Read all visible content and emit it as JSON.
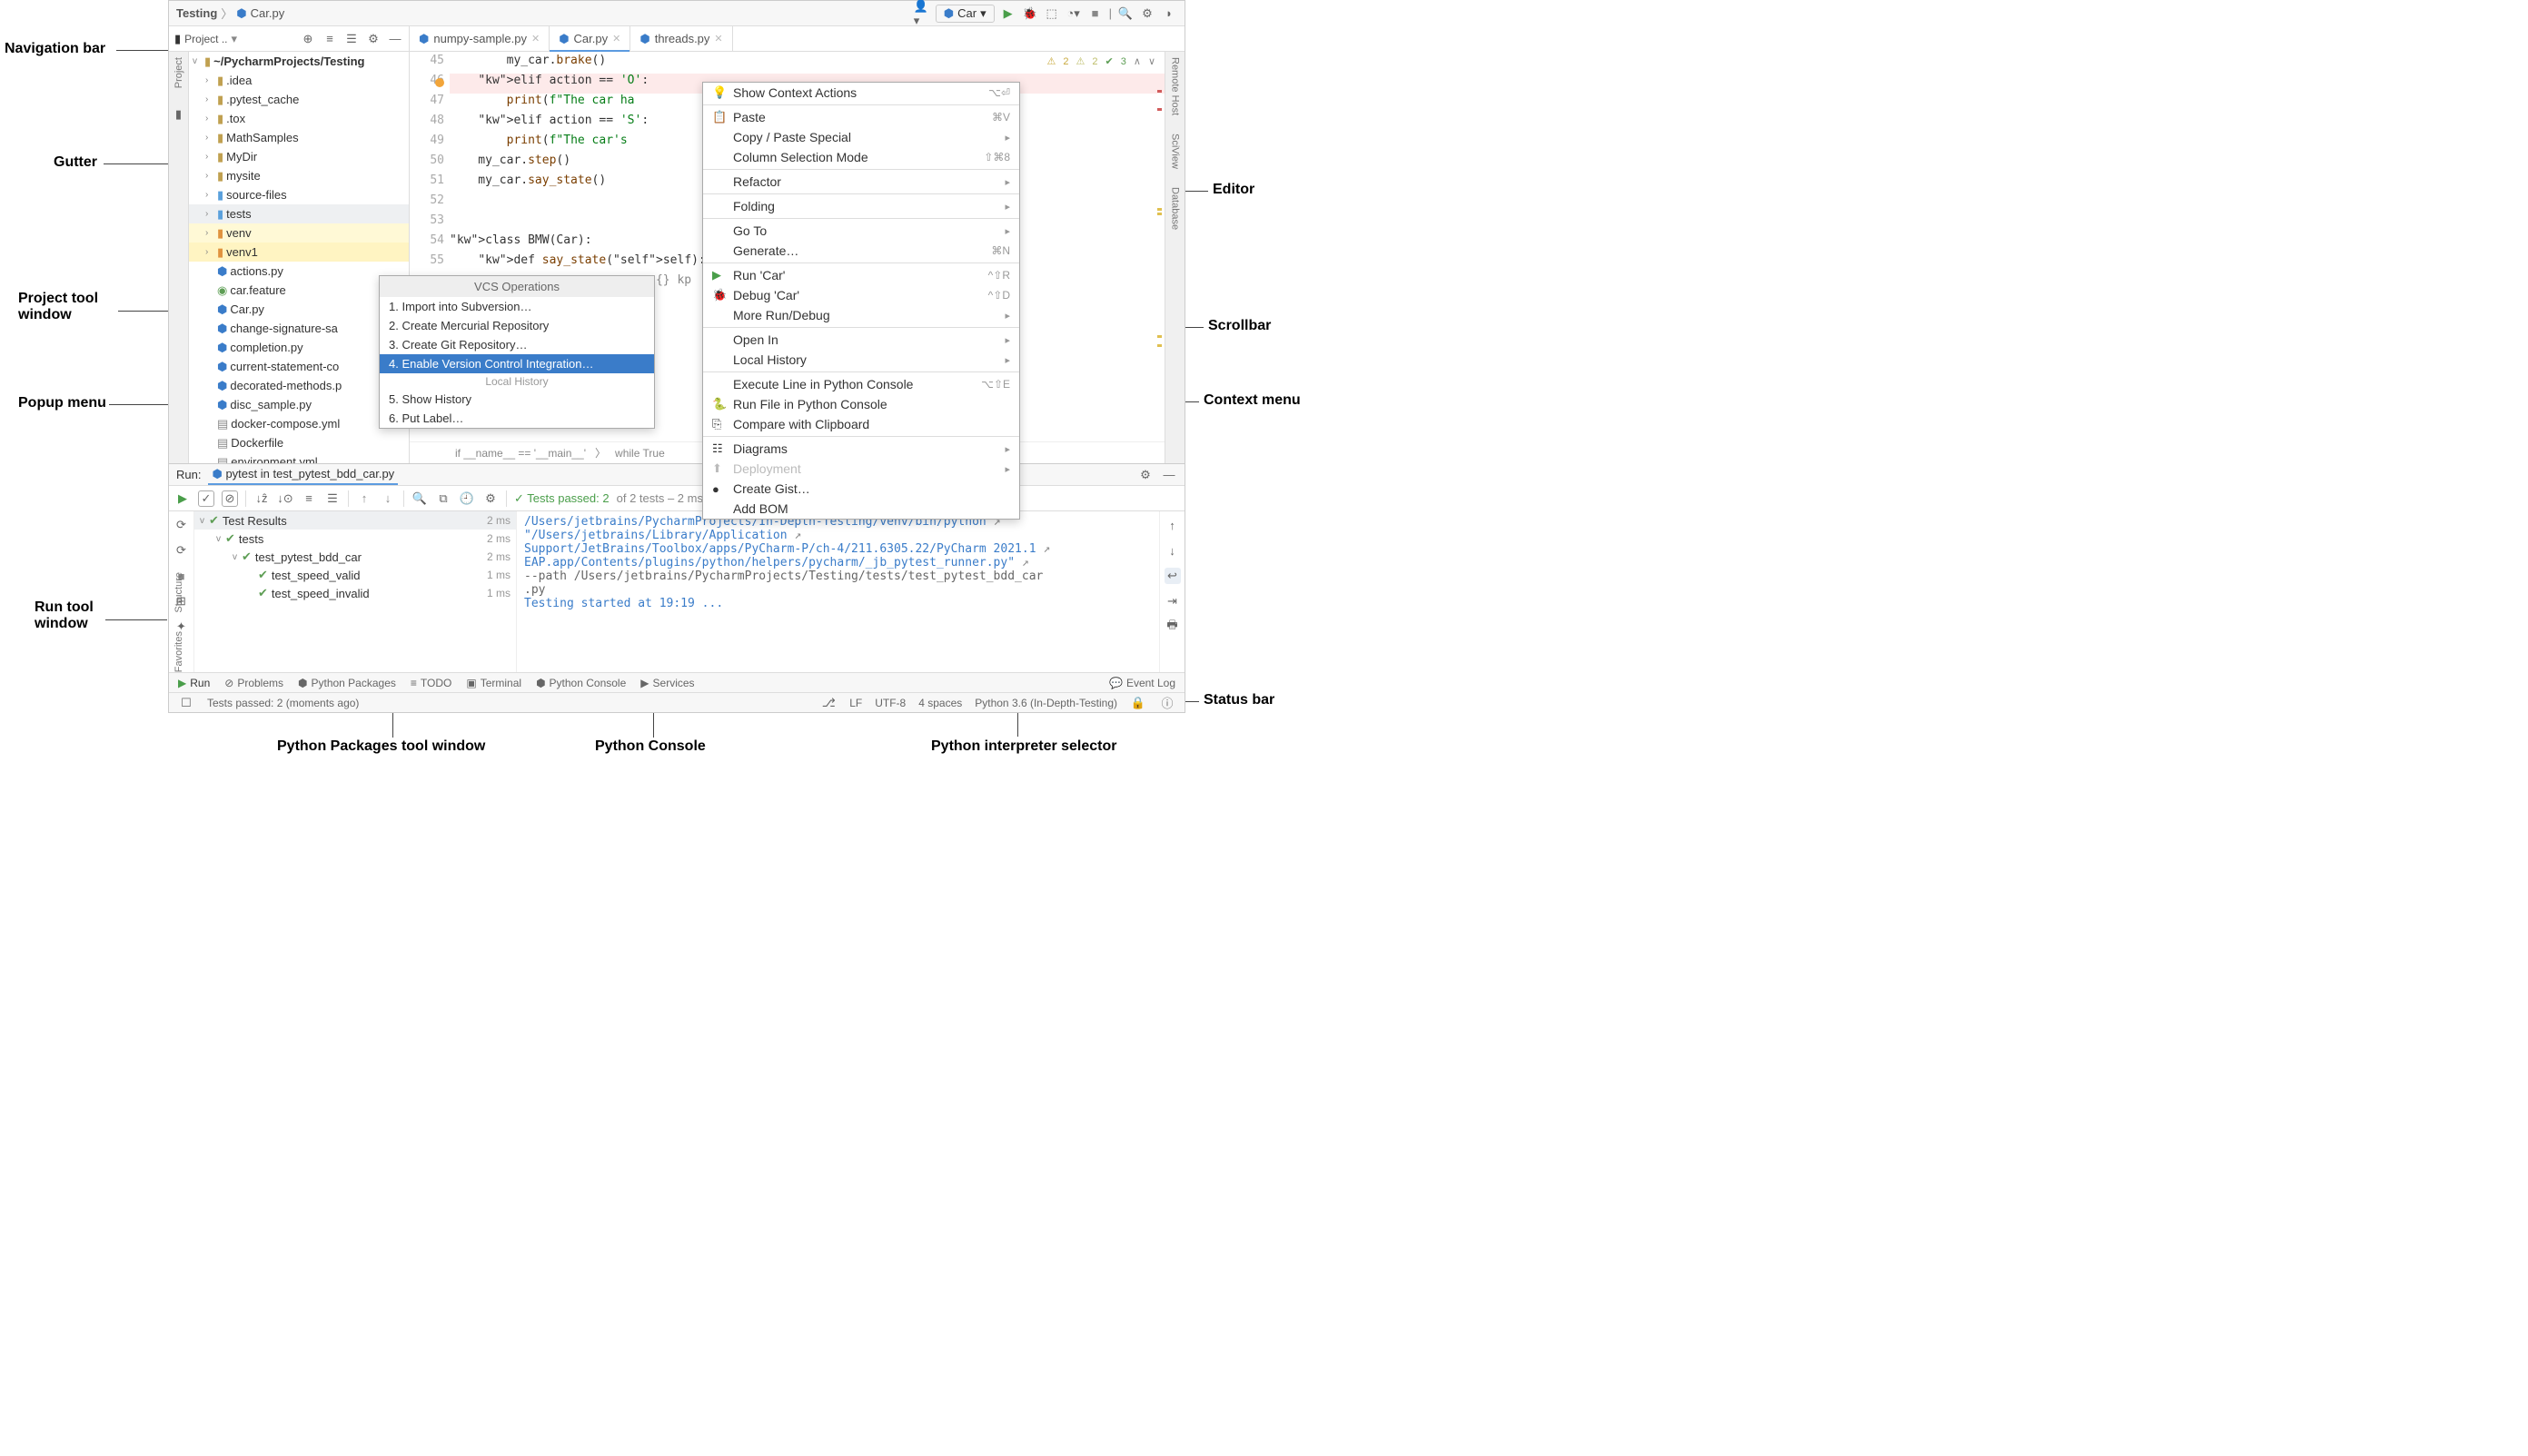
{
  "breadcrumb": {
    "project": "Testing",
    "file": "Car.py"
  },
  "run_config": {
    "name": "Car"
  },
  "project_header": "Project ..",
  "tabs": [
    {
      "name": "numpy-sample.py",
      "active": false
    },
    {
      "name": "Car.py",
      "active": true
    },
    {
      "name": "threads.py",
      "active": false
    }
  ],
  "tree": {
    "root": "~/PycharmProjects/Testing",
    "items": [
      {
        "name": ".idea",
        "icon": "folder"
      },
      {
        "name": ".pytest_cache",
        "icon": "folder"
      },
      {
        "name": ".tox",
        "icon": "folder"
      },
      {
        "name": "MathSamples",
        "icon": "folder"
      },
      {
        "name": "MyDir",
        "icon": "folder"
      },
      {
        "name": "mysite",
        "icon": "folder"
      },
      {
        "name": "source-files",
        "icon": "folder-blue"
      },
      {
        "name": "tests",
        "icon": "folder-blue",
        "hl": "gray"
      },
      {
        "name": "venv",
        "icon": "folder-orange",
        "hl": "yellow"
      },
      {
        "name": "venv1",
        "icon": "folder-orange",
        "hl": "yellow2"
      },
      {
        "name": "actions.py",
        "icon": "py"
      },
      {
        "name": "car.feature",
        "icon": "feature"
      },
      {
        "name": "Car.py",
        "icon": "py"
      },
      {
        "name": "change-signature-sa",
        "icon": "py"
      },
      {
        "name": "completion.py",
        "icon": "py"
      },
      {
        "name": "current-statement-co",
        "icon": "py"
      },
      {
        "name": "decorated-methods.p",
        "icon": "py"
      },
      {
        "name": "disc_sample.py",
        "icon": "py"
      },
      {
        "name": "docker-compose.yml",
        "icon": "file"
      },
      {
        "name": "Dockerfile",
        "icon": "file"
      },
      {
        "name": "environment.yml",
        "icon": "file"
      }
    ]
  },
  "gutter_lines": [
    45,
    46,
    47,
    48,
    49,
    50,
    51,
    52,
    53,
    54,
    55
  ],
  "breakpoint_line": 46,
  "code_lines": [
    "        my_car.brake()",
    "    elif action == 'O':",
    "        print(f\"The car ha",
    "    elif action == 'S':",
    "        print(f\"The car's                               kph\")",
    "    my_car.step()",
    "    my_car.say_state()",
    "",
    "",
    "class BMW(Car):",
    "    def say_state(self):"
  ],
  "code_extra": "                             {} kp",
  "inspections": {
    "warn": "2",
    "weak": "2",
    "ok": "3"
  },
  "editor_crumbs": [
    "if __name__ == '__main__'",
    "while True"
  ],
  "popup_vcs": {
    "title": "VCS Operations",
    "items": [
      "1. Import into Subversion…",
      "2. Create Mercurial Repository",
      "3. Create Git Repository…",
      "4. Enable Version Control Integration…"
    ],
    "selected": 3,
    "sep": "Local History",
    "after": [
      "5. Show History",
      "6. Put Label…"
    ]
  },
  "context_menu": [
    {
      "ic": "💡",
      "label": "Show Context Actions",
      "sc": "⌥⏎"
    },
    {
      "sep": true
    },
    {
      "ic": "📋",
      "label": "Paste",
      "sc": "⌘V"
    },
    {
      "label": "Copy / Paste Special",
      "sub": "▸"
    },
    {
      "label": "Column Selection Mode",
      "sc": "⇧⌘8"
    },
    {
      "sep": true
    },
    {
      "label": "Refactor",
      "sub": "▸"
    },
    {
      "sep": true
    },
    {
      "label": "Folding",
      "sub": "▸"
    },
    {
      "sep": true
    },
    {
      "label": "Go To",
      "sub": "▸"
    },
    {
      "label": "Generate…",
      "sc": "⌘N"
    },
    {
      "sep": true
    },
    {
      "ic": "▶",
      "green": true,
      "label": "Run 'Car'",
      "sc": "^⇧R"
    },
    {
      "ic": "🐞",
      "label": "Debug 'Car'",
      "sc": "^⇧D"
    },
    {
      "label": "More Run/Debug",
      "sub": "▸"
    },
    {
      "sep": true
    },
    {
      "label": "Open In",
      "sub": "▸"
    },
    {
      "label": "Local History",
      "sub": "▸"
    },
    {
      "sep": true
    },
    {
      "label": "Execute Line in Python Console",
      "sc": "⌥⇧E"
    },
    {
      "ic": "🐍",
      "label": "Run File in Python Console"
    },
    {
      "ic": "⎘",
      "label": "Compare with Clipboard"
    },
    {
      "sep": true
    },
    {
      "ic": "☷",
      "label": "Diagrams",
      "sub": "▸"
    },
    {
      "ic": "⬆",
      "label": "Deployment",
      "sub": "▸",
      "disabled": true
    },
    {
      "ic": "●",
      "label": "Create Gist…"
    },
    {
      "label": "Add BOM"
    }
  ],
  "run": {
    "label": "Run:",
    "session": "pytest in test_pytest_bdd_car.py",
    "summary_prefix": "✓ Tests passed: 2",
    "summary_suffix": " of 2 tests – 2 ms",
    "tree": [
      {
        "name": "Test Results",
        "time": "2 ms",
        "depth": 0,
        "caret": "v",
        "hdr": true
      },
      {
        "name": "tests",
        "time": "2 ms",
        "depth": 1,
        "caret": "v"
      },
      {
        "name": "test_pytest_bdd_car",
        "time": "2 ms",
        "depth": 2,
        "caret": "v"
      },
      {
        "name": "test_speed_valid",
        "time": "1 ms",
        "depth": 3
      },
      {
        "name": "test_speed_invalid",
        "time": "1 ms",
        "depth": 3
      }
    ],
    "console": [
      "/Users/jetbrains/PycharmProjects/In-Depth-Testing/venv/bin/python",
      "\"/Users/jetbrains/Library/Application",
      "Support/JetBrains/Toolbox/apps/PyCharm-P/ch-4/211.6305.22/PyCharm 2021.1",
      "EAP.app/Contents/plugins/python/helpers/pycharm/_jb_pytest_runner.py\"",
      "--path /Users/jetbrains/PycharmProjects/Testing/tests/test_pytest_bdd_car",
      ".py",
      "Testing started at 19:19 ..."
    ]
  },
  "tool_windows": {
    "run": "Run",
    "problems": "Problems",
    "packages": "Python Packages",
    "todo": "TODO",
    "terminal": "Terminal",
    "console": "Python Console",
    "services": "Services",
    "eventlog": "Event Log"
  },
  "status": {
    "tests": "Tests passed: 2 (moments ago)",
    "lf": "LF",
    "enc": "UTF-8",
    "indent": "4 spaces",
    "interpreter": "Python 3.6 (In-Depth-Testing)"
  },
  "side_tabs": {
    "left": [
      "Project"
    ],
    "right": [
      "Remote Host",
      "SciView",
      "Database"
    ],
    "left_bottom": [
      "Structure",
      "Favorites"
    ]
  },
  "callouts": {
    "nav": "Navigation bar",
    "gutter": "Gutter",
    "proj": "Project tool window",
    "popup": "Popup menu",
    "runwin": "Run tool window",
    "editor": "Editor",
    "scroll": "Scrollbar",
    "ctx": "Context menu",
    "status": "Status bar",
    "packages": "Python Packages tool window",
    "console": "Python Console",
    "interp": "Python interpreter selector"
  }
}
